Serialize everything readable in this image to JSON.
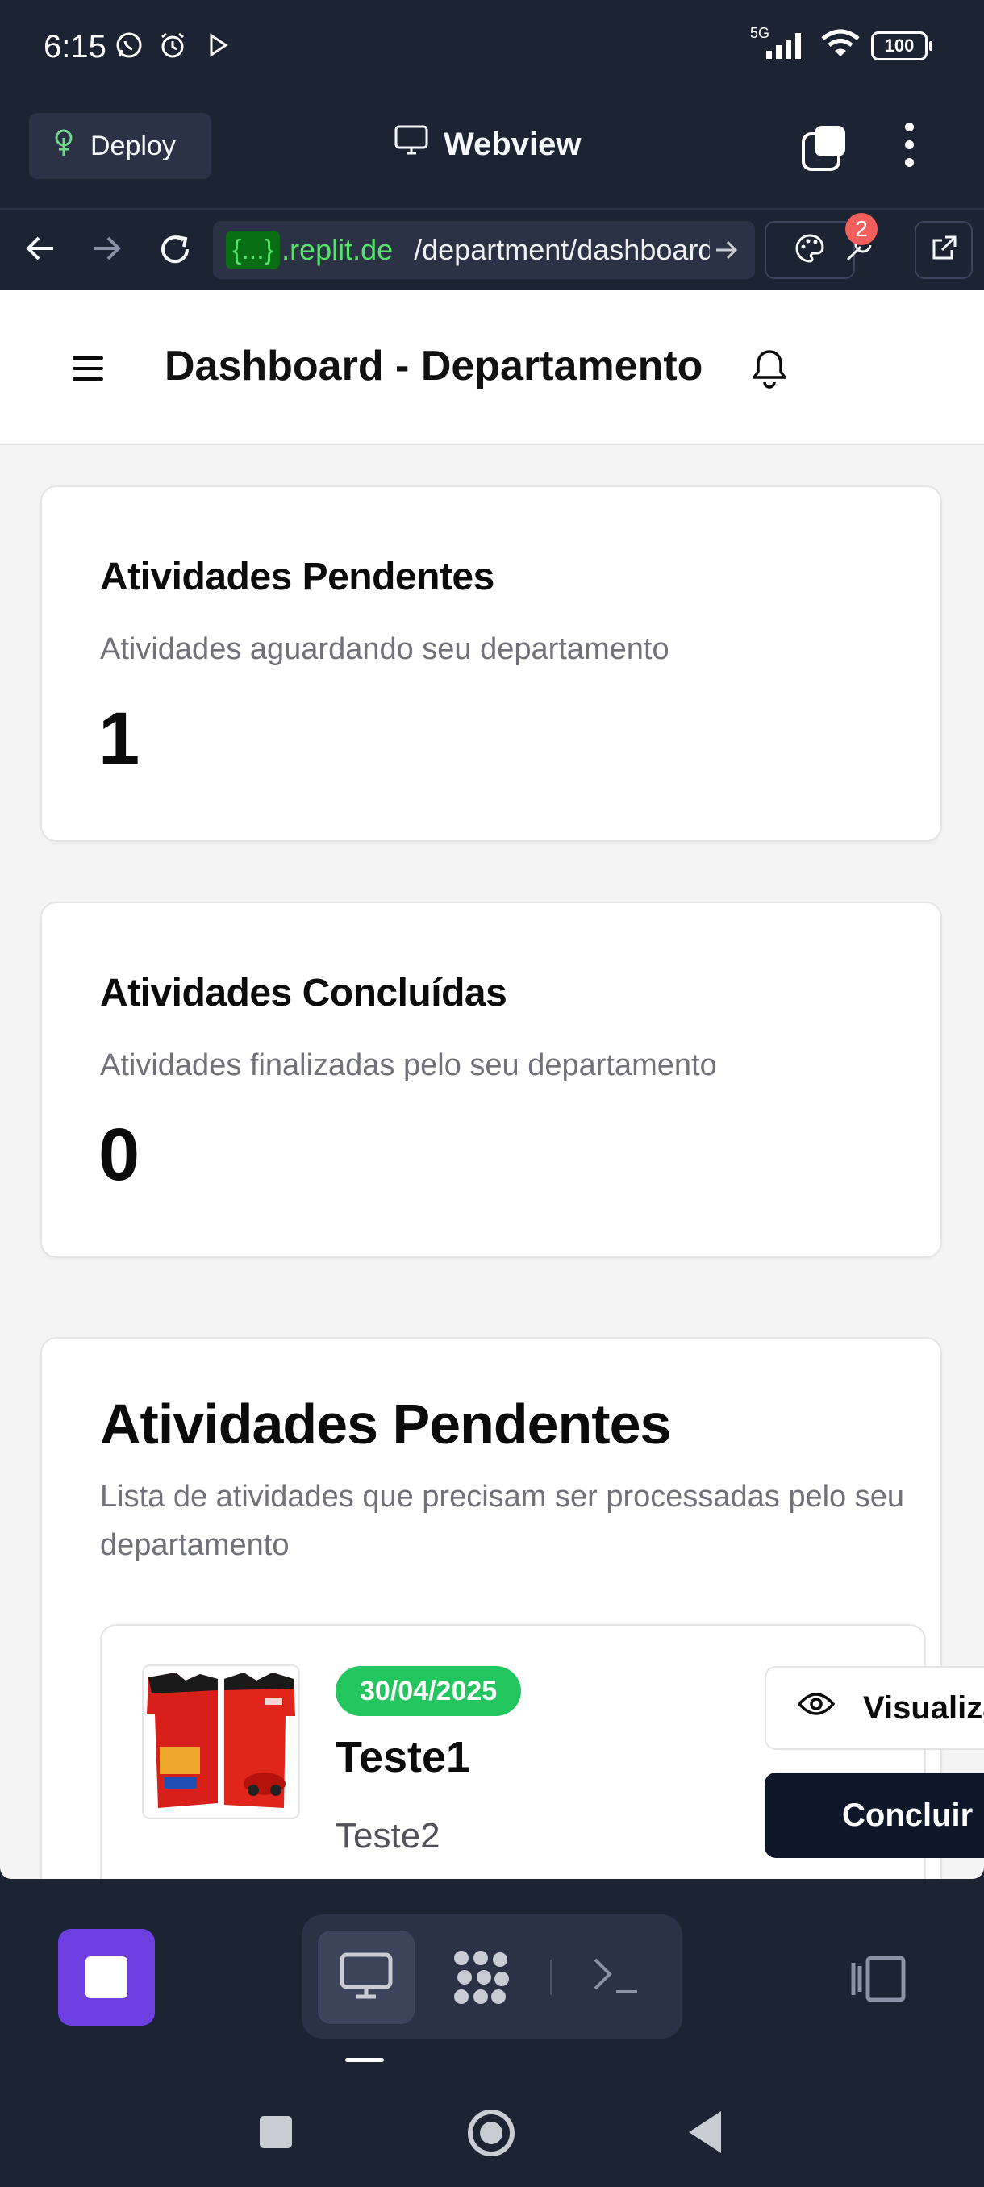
{
  "status_bar": {
    "time": "6:15",
    "network": "5G",
    "battery": "100"
  },
  "replit": {
    "deploy_label": "Deploy",
    "webview_label": "Webview",
    "url_chip": "{...}",
    "url_domain": ".replit.de",
    "url_path": "/department/dashboard",
    "devtools_badge": "2"
  },
  "app": {
    "header_title": "Dashboard - Departamento",
    "cards": [
      {
        "title": "Atividades Pendentes",
        "subtitle": "Atividades aguardando seu departamento",
        "value": "1"
      },
      {
        "title": "Atividades Concluídas",
        "subtitle": "Atividades finalizadas pelo seu departamento",
        "value": "0"
      }
    ],
    "pending_section": {
      "title": "Atividades Pendentes",
      "subtitle": "Lista de atividades que precisam ser processadas pelo seu departamento"
    },
    "activity": {
      "date": "30/04/2025",
      "title": "Teste1",
      "description": "Teste2",
      "view_label": "Visualizar",
      "complete_label": "Concluir"
    }
  },
  "colors": {
    "accent_green": "#22c55e",
    "primary_dark": "#0f172a",
    "replit_bg": "#1c2333",
    "stop_purple": "#6d3ee0"
  }
}
